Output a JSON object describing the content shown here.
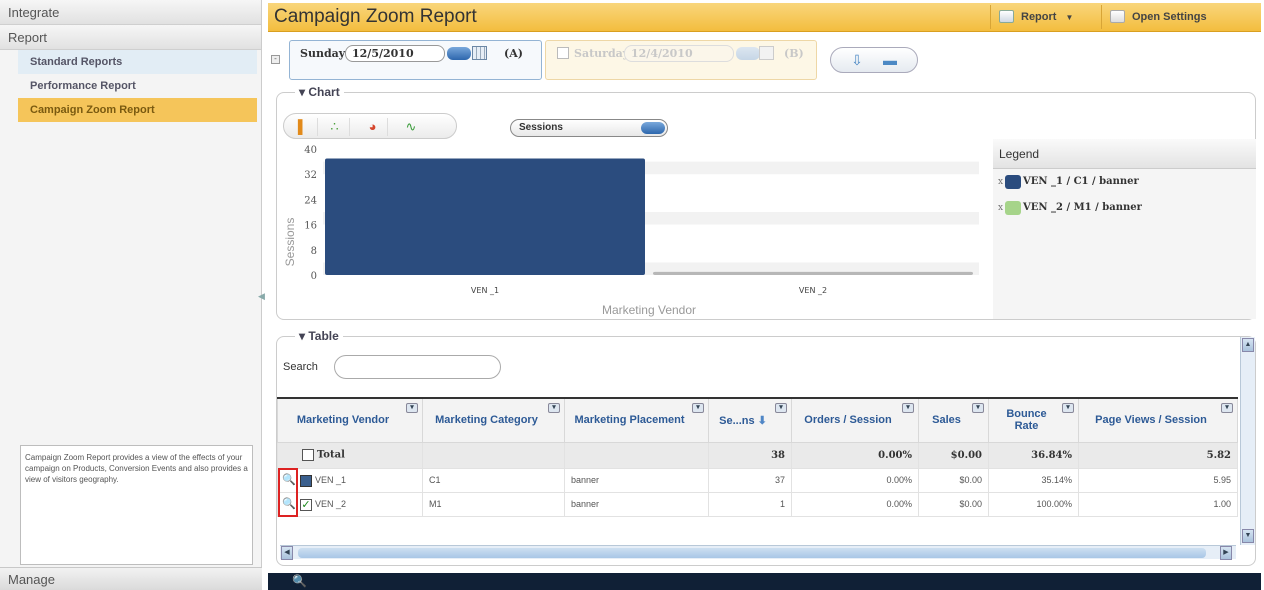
{
  "sidebar": {
    "integrate": "Integrate",
    "report": "Report",
    "items": [
      {
        "label": "Standard Reports"
      },
      {
        "label": "Performance Report"
      },
      {
        "label": "Campaign Zoom Report"
      }
    ],
    "description": "Campaign Zoom Report provides a view of the effects of your campaign on Products, Conversion Events and also provides a view of visitors geography.",
    "manage": "Manage"
  },
  "header": {
    "title": "Campaign Zoom Report",
    "report_label": "Report",
    "report_arrow": "▼",
    "settings_label": "Open Settings"
  },
  "date_a": {
    "day": "Sunday",
    "date": "12/5/2010",
    "tag": "(A)"
  },
  "date_b": {
    "day": "Saturday",
    "date": "12/4/2010",
    "tag": "(B)"
  },
  "chart_section": {
    "label": "▾ Chart",
    "metric": "Sessions",
    "legend_title": "Legend",
    "legend": [
      {
        "label": "VEN _1 / C1 / banner",
        "color": "#2b4c7e"
      },
      {
        "label": "VEN _2 / M1 / banner",
        "color": "#a6d48a"
      }
    ]
  },
  "chart_data": {
    "type": "bar",
    "categories": [
      "VEN _1",
      "VEN _2"
    ],
    "series": [
      {
        "name": "VEN _1 / C1 / banner",
        "values": [
          37,
          0
        ],
        "color": "#2b4c7e"
      },
      {
        "name": "VEN _2 / M1 / banner",
        "values": [
          0,
          1
        ],
        "color": "#a6d48a"
      }
    ],
    "xlabel": "Marketing Vendor",
    "ylabel": "Sessions",
    "ylim": [
      0,
      40
    ],
    "yticks": [
      "40",
      "32",
      "24",
      "16",
      "8",
      "0"
    ],
    "grid": true,
    "legend_position": "right"
  },
  "table_section": {
    "label": "▾ Table",
    "search_label": "Search",
    "search_value": "",
    "columns": [
      "Marketing Vendor",
      "Marketing Category",
      "Marketing Placement",
      "Se...ns",
      "Orders / Session",
      "Sales",
      "Bounce Rate",
      "Page Views / Session"
    ],
    "total": {
      "label": "Total",
      "sessions": "38",
      "orders": "0.00%",
      "sales": "$0.00",
      "bounce": "36.84%",
      "pageviews": "5.82"
    },
    "rows": [
      {
        "vendor": "VEN _1",
        "category": "C1",
        "placement": "banner",
        "sessions": "37",
        "orders": "0.00%",
        "sales": "$0.00",
        "bounce": "35.14%",
        "pageviews": "5.95"
      },
      {
        "vendor": "VEN _2",
        "category": "M1",
        "placement": "banner",
        "sessions": "1",
        "orders": "0.00%",
        "sales": "$0.00",
        "bounce": "100.00%",
        "pageviews": "1.00"
      }
    ]
  },
  "colors": {
    "header": "#f4c44f",
    "selected_nav": "#f5c55a",
    "bar_ven1": "#2b4c7e",
    "bar_ven2": "#a6d48a",
    "bottom_bar": "#102036"
  }
}
